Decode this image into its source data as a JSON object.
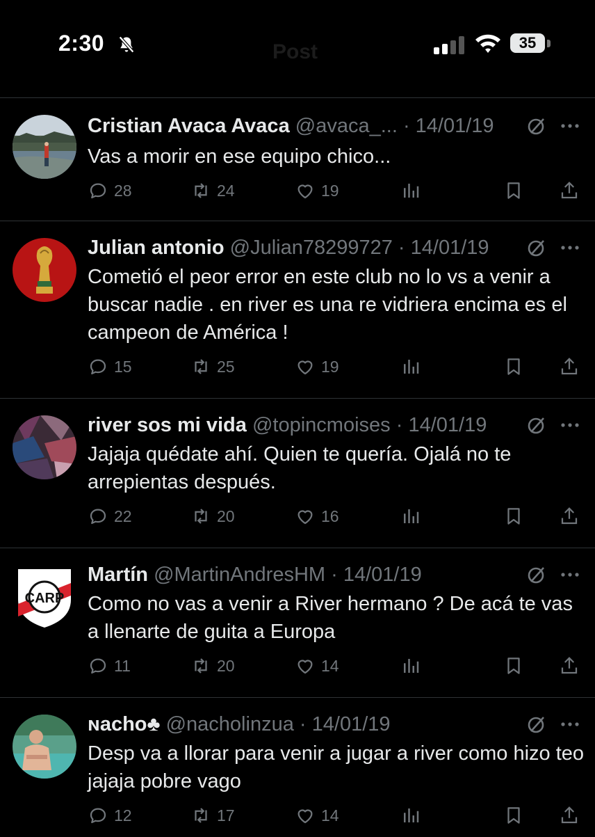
{
  "status_bar": {
    "time": "2:30",
    "battery": "35"
  },
  "header": {
    "title": "Post"
  },
  "replies": [
    {
      "name": "Cristian Avaca Avaca",
      "handle": "@avaca_...",
      "date": "14/01/19",
      "text": "Vas a morir en ese equipo chico...",
      "replies": "28",
      "reposts": "24",
      "likes": "19"
    },
    {
      "name": "Julian antonio",
      "handle": "@Julian78299727",
      "date": "14/01/19",
      "text": "Cometió el peor error en este club no lo vs a venir a buscar nadie . en river es una re vidriera encima es el campeon de América !",
      "replies": "15",
      "reposts": "25",
      "likes": "19"
    },
    {
      "name": "river sos mi vida",
      "handle": "@topincmoises",
      "date": "14/01/19",
      "text": "Jajaja quédate ahí.  Quien te quería. Ojalá no te arrepientas después.",
      "replies": "22",
      "reposts": "20",
      "likes": "16"
    },
    {
      "name": "Martín",
      "handle": "@MartinAndresHM",
      "date": "14/01/19",
      "text": "Como no vas a venir a River hermano ? De acá te vas a llenarte de guita a Europa",
      "replies": "11",
      "reposts": "20",
      "likes": "14"
    },
    {
      "name": "ɴacho",
      "name_suffix": "♣",
      "handle": "@nacholinzua",
      "date": "14/01/19",
      "text": "Desp va a llorar para venir a jugar a river como hizo teo jajaja pobre vago",
      "replies": "12",
      "reposts": "17",
      "likes": "14"
    }
  ],
  "ui": {
    "separator": " · "
  }
}
